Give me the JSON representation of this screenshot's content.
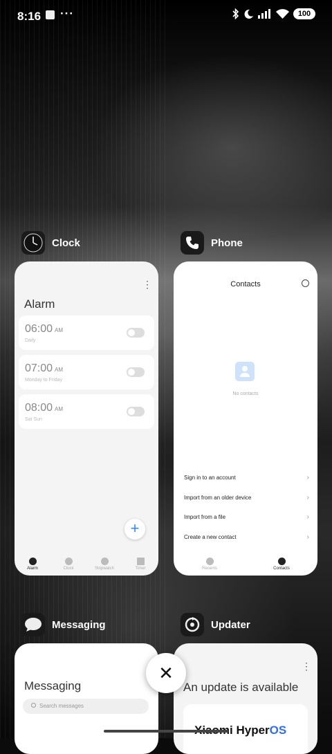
{
  "status_bar": {
    "time": "8:16",
    "overflow": "···",
    "icons": [
      "bluetooth-icon",
      "moon-icon",
      "signal-icon",
      "wifi-icon"
    ],
    "battery": "100"
  },
  "recents": [
    {
      "app": "Clock",
      "icon": "clock-icon",
      "screen": {
        "title": "Alarm",
        "alarms": [
          {
            "time": "06:00",
            "ampm": "AM",
            "repeat": "Daily",
            "enabled": false
          },
          {
            "time": "07:00",
            "ampm": "AM",
            "repeat": "Monday to Friday",
            "enabled": false
          },
          {
            "time": "08:00",
            "ampm": "AM",
            "repeat": "Sat Sun",
            "enabled": false
          }
        ],
        "add_label": "+",
        "tabs": [
          {
            "label": "Alarm",
            "icon": "alarm-icon",
            "active": true
          },
          {
            "label": "Clock",
            "icon": "clock-tab-icon",
            "active": false
          },
          {
            "label": "Stopwatch",
            "icon": "stopwatch-icon",
            "active": false
          },
          {
            "label": "Timer",
            "icon": "hourglass-icon",
            "active": false
          }
        ]
      }
    },
    {
      "app": "Phone",
      "icon": "phone-icon",
      "screen": {
        "title": "Contacts",
        "empty_text": "No contacts",
        "options": [
          "Sign in to an account",
          "Import from an older device",
          "Import from a file",
          "Create a new contact"
        ],
        "tabs": [
          {
            "label": "Recents",
            "icon": "phone-tab-icon",
            "active": false
          },
          {
            "label": "Contacts",
            "icon": "person-icon",
            "active": true
          }
        ]
      }
    },
    {
      "app": "Messaging",
      "icon": "messaging-icon",
      "screen": {
        "title": "Messaging",
        "search_placeholder": "Search messages"
      }
    },
    {
      "app": "Updater",
      "icon": "updater-icon",
      "screen": {
        "title": "An update is available",
        "brand": "Xiaomi Hyper",
        "brand_suffix": "OS"
      }
    }
  ],
  "close_all": "✕",
  "colors": {
    "accent": "#2f86ff",
    "hyperos_blue": "#2f6df6"
  }
}
